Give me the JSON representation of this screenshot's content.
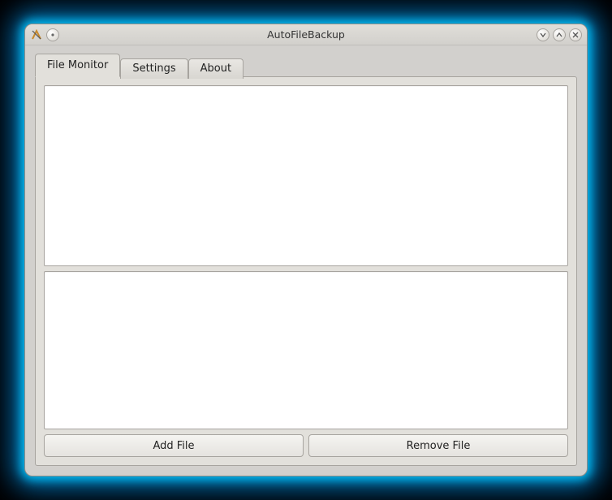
{
  "window": {
    "title": "AutoFileBackup"
  },
  "tabs": [
    {
      "label": "File Monitor",
      "active": true
    },
    {
      "label": "Settings",
      "active": false
    },
    {
      "label": "About",
      "active": false
    }
  ],
  "buttons": {
    "add_file": "Add File",
    "remove_file": "Remove File"
  },
  "titlebar_icons": {
    "app": "app-icon",
    "pin": "●",
    "min": "⌄",
    "max": "⌃",
    "close": "✕"
  }
}
